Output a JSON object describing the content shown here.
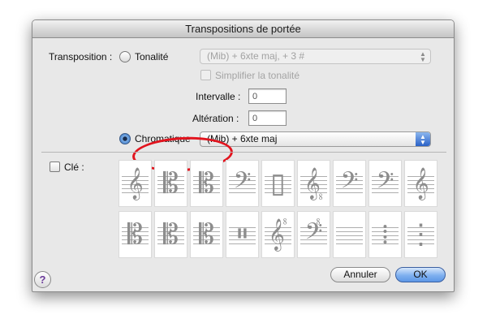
{
  "dialog": {
    "title": "Transpositions de portée"
  },
  "transposition": {
    "label": "Transposition :",
    "tonalite_label": "Tonalité",
    "tonalite_value": "(Mib) + 6xte maj, + 3 #",
    "simplifier_label": "Simplifier la tonalité",
    "intervalle_label": "Intervalle :",
    "intervalle_value": "0",
    "alteration_label": "Altération :",
    "alteration_value": "0",
    "chromatique_label": "Chromatique",
    "chromatique_value": "(Mib) + 6xte maj",
    "selected_mode": "Chromatique"
  },
  "cle": {
    "label": "Clé :",
    "checked": false,
    "clefs": [
      {
        "name": "treble-clef",
        "glyph": "𝄞"
      },
      {
        "name": "alto-clef",
        "glyph": "𝄡"
      },
      {
        "name": "tenor-clef",
        "glyph": "𝄡"
      },
      {
        "name": "bass-clef",
        "glyph": "𝄢"
      },
      {
        "name": "percussion-clef",
        "glyph": "▯"
      },
      {
        "name": "treble-8vb-clef",
        "glyph": "𝄠"
      },
      {
        "name": "baritone-f-clef",
        "glyph": "𝄢"
      },
      {
        "name": "sub-bass-clef",
        "glyph": "𝄢"
      },
      {
        "name": "french-violin-clef",
        "glyph": "𝄞"
      },
      {
        "name": "soprano-clef",
        "glyph": "𝄡"
      },
      {
        "name": "mezzo-soprano-clef",
        "glyph": "𝄡"
      },
      {
        "name": "baritone-c-clef",
        "glyph": "𝄡"
      },
      {
        "name": "percussion-clef-2",
        "glyph": "𝄥"
      },
      {
        "name": "treble-8va-clef",
        "glyph": "𝄟"
      },
      {
        "name": "bass-8va-clef",
        "glyph": "𝄣"
      },
      {
        "name": "blank-clef",
        "glyph": ""
      },
      {
        "name": "tab-clef-short",
        "glyph": "⁞"
      },
      {
        "name": "tab-clef-long",
        "glyph": "⋮"
      }
    ]
  },
  "buttons": {
    "help": "?",
    "cancel": "Annuler",
    "ok": "OK"
  },
  "colors": {
    "highlight_ellipse": "#e2141e",
    "default_button": "#5d97e6"
  }
}
